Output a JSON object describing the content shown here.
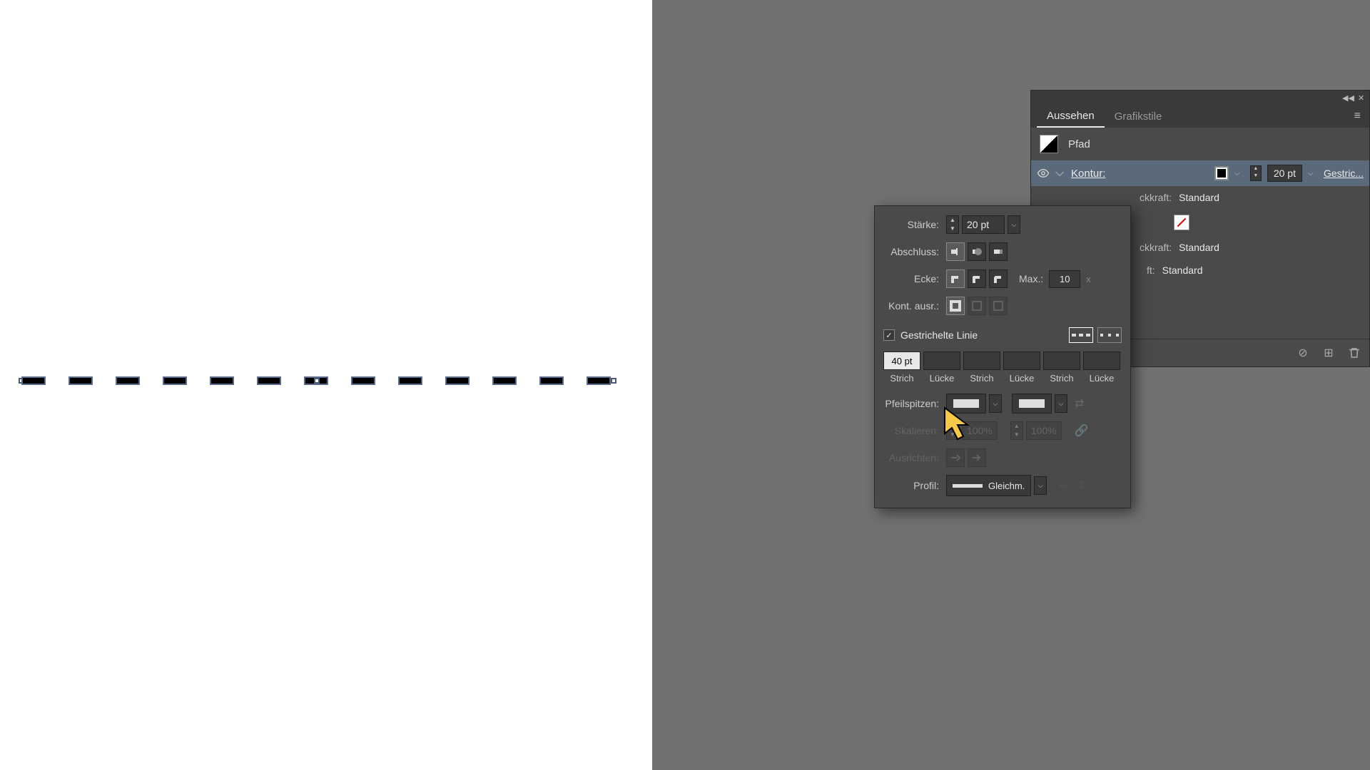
{
  "panel": {
    "tabs": {
      "appearance": "Aussehen",
      "graphic_styles": "Grafikstile"
    },
    "object_type": "Pfad",
    "stroke": {
      "label": "Kontur:",
      "weight": "20 pt",
      "dash_link": "Gestric..."
    },
    "opacity_labels": {
      "a": "ckkraft:",
      "b": "ckkraft:",
      "c": "ft:"
    },
    "opacity_value": "Standard"
  },
  "flyout": {
    "labels": {
      "weight": "Stärke:",
      "cap": "Abschluss:",
      "corner": "Ecke:",
      "miter": "Max.:",
      "align": "Kont. ausr.:",
      "dashed": "Gestrichelte Linie",
      "arrow": "Pfeilspitzen:",
      "scale": "Skalieren:",
      "align_arrow": "Ausrichten:",
      "profile": "Profil:"
    },
    "weight": "20 pt",
    "miter": "10",
    "miter_x": "x",
    "dash_values": [
      "40 pt",
      "",
      "",
      "",
      "",
      ""
    ],
    "dash_labels": [
      "Strich",
      "Lücke",
      "Strich",
      "Lücke",
      "Strich",
      "Lücke"
    ],
    "scale_values": [
      "100%",
      "100%"
    ],
    "profile_value": "Gleichm."
  }
}
